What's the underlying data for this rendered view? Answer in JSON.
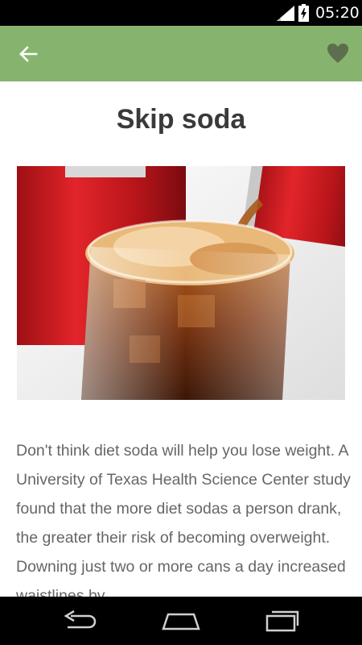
{
  "status_bar": {
    "time": "05:20",
    "icons": [
      "signal-icon",
      "battery-icon"
    ]
  },
  "app_bar": {
    "background": "#86b46e",
    "back_icon": "arrow-left-icon",
    "favorite_icon": "heart-icon"
  },
  "article": {
    "title": "Skip soda",
    "image": "soda-being-poured-into-glass-with-ice",
    "body": "Don't think diet soda will help you lose weight. A University of Texas Health Science Center study found that the more diet sodas a person drank, the greater their risk of becoming overweight. Downing just two or more cans a day increased waistlines by"
  },
  "nav_bar": {
    "icons": [
      "back-nav-icon",
      "home-nav-icon",
      "recents-nav-icon"
    ]
  }
}
